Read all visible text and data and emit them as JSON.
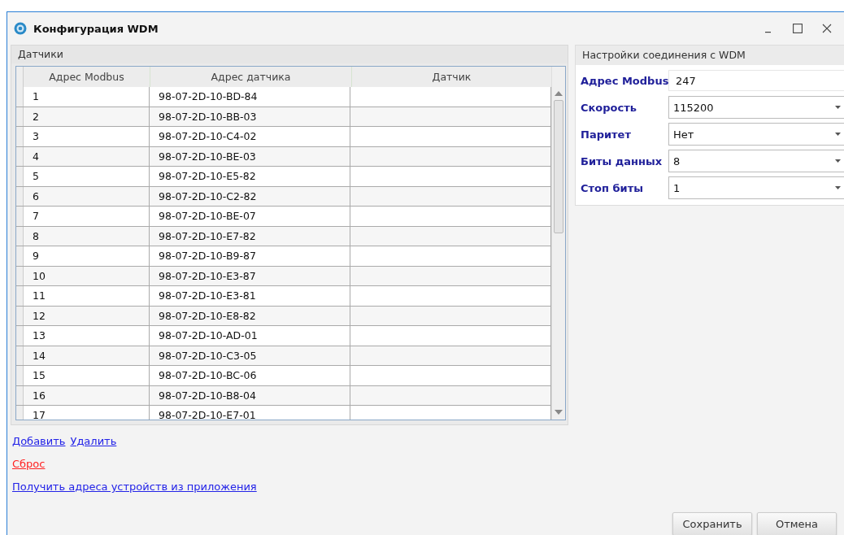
{
  "window": {
    "title": "Конфигурация WDM"
  },
  "sensors": {
    "title": "Датчики",
    "columns": [
      "Адрес Modbus",
      "Адрес датчика",
      "Датчик"
    ],
    "rows": [
      {
        "modbus": "1",
        "address": "98-07-2D-10-BD-84",
        "sensor": ""
      },
      {
        "modbus": "2",
        "address": "98-07-2D-10-BB-03",
        "sensor": ""
      },
      {
        "modbus": "3",
        "address": "98-07-2D-10-C4-02",
        "sensor": ""
      },
      {
        "modbus": "4",
        "address": "98-07-2D-10-BE-03",
        "sensor": ""
      },
      {
        "modbus": "5",
        "address": "98-07-2D-10-E5-82",
        "sensor": ""
      },
      {
        "modbus": "6",
        "address": "98-07-2D-10-C2-82",
        "sensor": ""
      },
      {
        "modbus": "7",
        "address": "98-07-2D-10-BE-07",
        "sensor": ""
      },
      {
        "modbus": "8",
        "address": "98-07-2D-10-E7-82",
        "sensor": ""
      },
      {
        "modbus": "9",
        "address": "98-07-2D-10-B9-87",
        "sensor": ""
      },
      {
        "modbus": "10",
        "address": "98-07-2D-10-E3-87",
        "sensor": ""
      },
      {
        "modbus": "11",
        "address": "98-07-2D-10-E3-81",
        "sensor": ""
      },
      {
        "modbus": "12",
        "address": "98-07-2D-10-E8-82",
        "sensor": ""
      },
      {
        "modbus": "13",
        "address": "98-07-2D-10-AD-01",
        "sensor": ""
      },
      {
        "modbus": "14",
        "address": "98-07-2D-10-C3-05",
        "sensor": ""
      },
      {
        "modbus": "15",
        "address": "98-07-2D-10-BC-06",
        "sensor": ""
      },
      {
        "modbus": "16",
        "address": "98-07-2D-10-B8-04",
        "sensor": ""
      },
      {
        "modbus": "17",
        "address": "98-07-2D-10-E7-01",
        "sensor": ""
      }
    ]
  },
  "links": [
    [
      {
        "label": "Добавить",
        "kind": "normal"
      },
      {
        "label": "Удалить",
        "kind": "normal"
      }
    ],
    [
      {
        "label": "Сброс",
        "kind": "danger"
      }
    ],
    [
      {
        "label": "Получить адреса устройств из приложения",
        "kind": "normal"
      }
    ]
  ],
  "connection": {
    "title": "Настройки соединения с WDM",
    "fields": [
      {
        "label": "Адрес Modbus",
        "value": "247",
        "kind": "text"
      },
      {
        "label": "Скорость",
        "value": "115200",
        "kind": "dropdown"
      },
      {
        "label": "Паритет",
        "value": "Нет",
        "kind": "dropdown"
      },
      {
        "label": "Биты данных",
        "value": "8",
        "kind": "dropdown"
      },
      {
        "label": "Стоп биты",
        "value": "1",
        "kind": "dropdown"
      }
    ]
  },
  "buttons": [
    "Сохранить",
    "Отмена"
  ]
}
